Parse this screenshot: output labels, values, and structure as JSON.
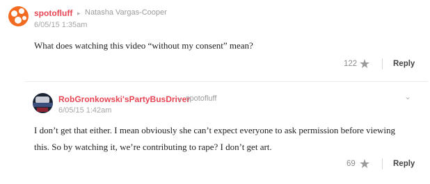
{
  "comments": [
    {
      "author": "spotofluff",
      "reply_to": "Natasha Vargas-Cooper",
      "timestamp": "6/05/15 1:35am",
      "body": "What does watching this video “without my consent” mean?",
      "star_count": "122",
      "reply_label": "Reply",
      "avatar_color": "#f26b21"
    },
    {
      "author": "RobGronkowski'sPartyBusDriver",
      "reply_to": "spotofluff",
      "timestamp": "6/05/15 1:42am",
      "body_line1": "I don’t get that either. I mean obviously she can’t expect everyone to ask permission before viewing",
      "body_line2": "this. So by watching it, we’re contributing to rape? I don’t get art.",
      "star_count": "69",
      "reply_label": "Reply"
    }
  ],
  "icons": {
    "reply_arrow": "▸",
    "star": "★",
    "chevron": "⌄"
  },
  "accent_color": "#e84553"
}
